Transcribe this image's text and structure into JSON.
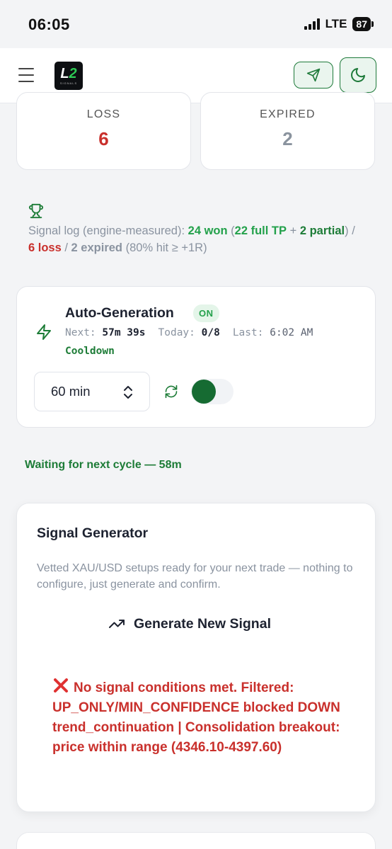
{
  "status_bar": {
    "time": "06:05",
    "network": "LTE",
    "battery": "87"
  },
  "header": {
    "logo_text": "L2",
    "logo_sub": "SIGNALS"
  },
  "stats": {
    "loss": {
      "label": "LOSS",
      "value": "6"
    },
    "expired": {
      "label": "EXPIRED",
      "value": "2"
    }
  },
  "signal_log": {
    "prefix": "Signal log (engine-measured): ",
    "won": "24 won",
    "open_paren": " (",
    "full_tp": "22 full TP",
    "plus": " + ",
    "partial": "2 partial",
    "close_sep": ") / ",
    "loss": "6 loss",
    "sep2": " / ",
    "expired": "2 expired",
    "hit_rate": " (80% hit ≥ +1R)"
  },
  "auto_generation": {
    "title": "Auto-Generation",
    "status": "ON",
    "next_label": "Next:",
    "next_value": "57m 39s",
    "today_label": "Today:",
    "today_value": "0/8",
    "last_label": "Last:",
    "last_value": "6:02 AM",
    "state": "Cooldown",
    "interval": "60 min",
    "enabled": true
  },
  "waiting_text": "Waiting for next cycle — 58m",
  "signal_generator": {
    "title": "Signal Generator",
    "description": "Vetted XAU/USD setups ready for your next trade — nothing to configure, just generate and confirm.",
    "button_label": "Generate New Signal",
    "error": "No signal conditions met. Filtered: UP_ONLY/MIN_CONFIDENCE blocked DOWN trend_continuation | Consolidation breakout: price within range (4346.10-4397.60)"
  },
  "colors": {
    "accent_green": "#1d7c37",
    "bright_green": "#23a14b",
    "loss_red": "#c9302c",
    "muted_gray": "#8a93a0"
  },
  "icons": [
    "menu-icon",
    "send-icon",
    "moon-icon",
    "trophy-icon",
    "bolt-icon",
    "chevron-updown-icon",
    "refresh-icon",
    "trending-up-icon",
    "x-icon"
  ]
}
